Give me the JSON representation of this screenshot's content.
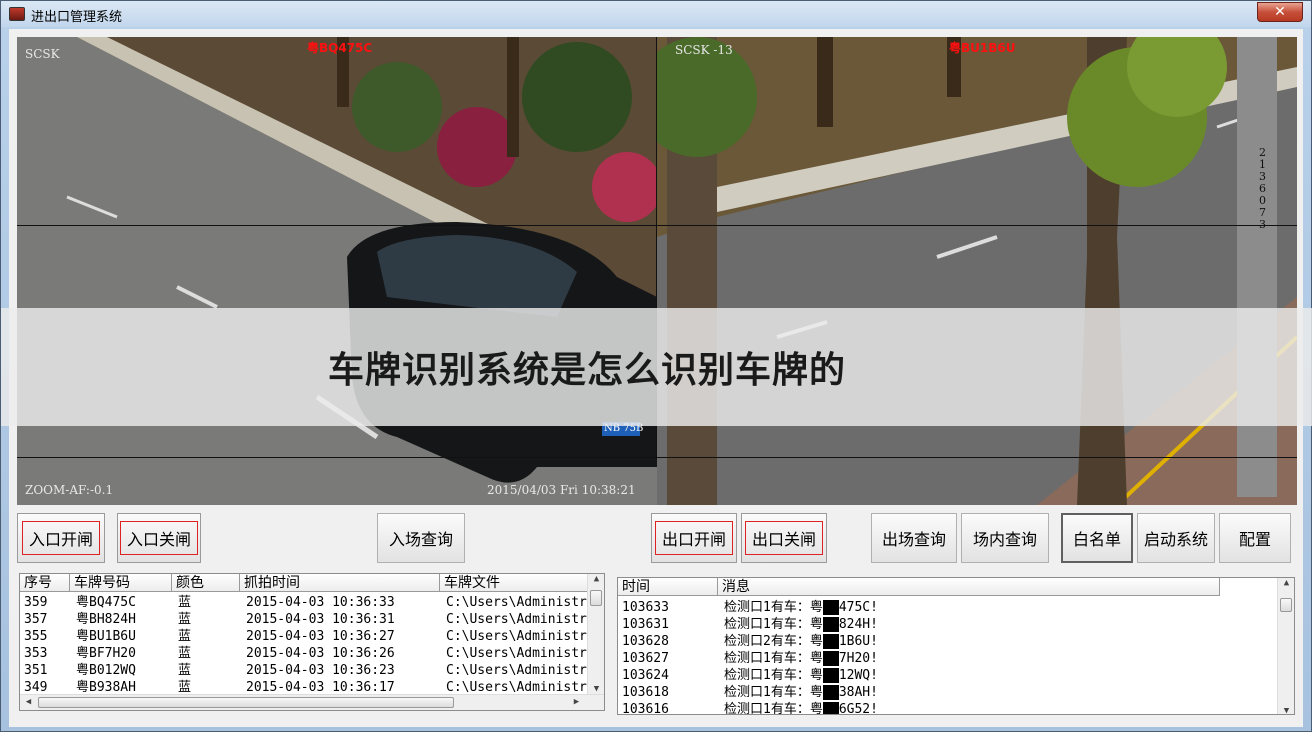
{
  "window": {
    "title": "进出口管理系统",
    "close_label": "✕"
  },
  "cameras": {
    "left": {
      "label": "SCSK",
      "plate": "粤BQ475C",
      "zoom": "ZOOM-AF:-0.1",
      "datetime": "2015/04/03 Fri 10:38:21",
      "car_plate": "NB 75B"
    },
    "right": {
      "label": "SCSK -13",
      "plate": "粤BU1B6U",
      "pole_number": "2136073"
    }
  },
  "banner": {
    "text": "车牌识别系统是怎么识别车牌的"
  },
  "buttons": {
    "entry_open": "入口开闸",
    "entry_close": "入口关闸",
    "entry_query": "入场查询",
    "exit_open": "出口开闸",
    "exit_close": "出口关闸",
    "exit_query": "出场查询",
    "inside_query": "场内查询",
    "whitelist": "白名单",
    "start_system": "启动系统",
    "config": "配置"
  },
  "records": {
    "headers": [
      "序号",
      "车牌号码",
      "颜色",
      "抓拍时间",
      "车牌文件"
    ],
    "rows": [
      [
        "359",
        "粤BQ475C",
        "蓝",
        "2015-04-03 10:36:33",
        "C:\\Users\\Administr"
      ],
      [
        "357",
        "粤BH824H",
        "蓝",
        "2015-04-03 10:36:31",
        "C:\\Users\\Administr"
      ],
      [
        "355",
        "粤BU1B6U",
        "蓝",
        "2015-04-03 10:36:27",
        "C:\\Users\\Administr"
      ],
      [
        "353",
        "粤BF7H20",
        "蓝",
        "2015-04-03 10:36:26",
        "C:\\Users\\Administr"
      ],
      [
        "351",
        "粤B012WQ",
        "蓝",
        "2015-04-03 10:36:23",
        "C:\\Users\\Administr"
      ],
      [
        "349",
        "粤B938AH",
        "蓝",
        "2015-04-03 10:36:17",
        "C:\\Users\\Administr"
      ]
    ]
  },
  "messages": {
    "headers": [
      "时间",
      "消息"
    ],
    "rows": [
      [
        "103633",
        "检测口1有车：粤",
        "475C!"
      ],
      [
        "103631",
        "检测口1有车：粤",
        "824H!"
      ],
      [
        "103628",
        "检测口2有车：粤",
        "1B6U!"
      ],
      [
        "103627",
        "检测口1有车：粤",
        "7H20!"
      ],
      [
        "103624",
        "检测口1有车：粤",
        "12WQ!"
      ],
      [
        "103618",
        "检测口1有车：粤",
        "38AH!"
      ],
      [
        "103616",
        "检测口1有车：粤",
        "6G52!"
      ]
    ]
  }
}
